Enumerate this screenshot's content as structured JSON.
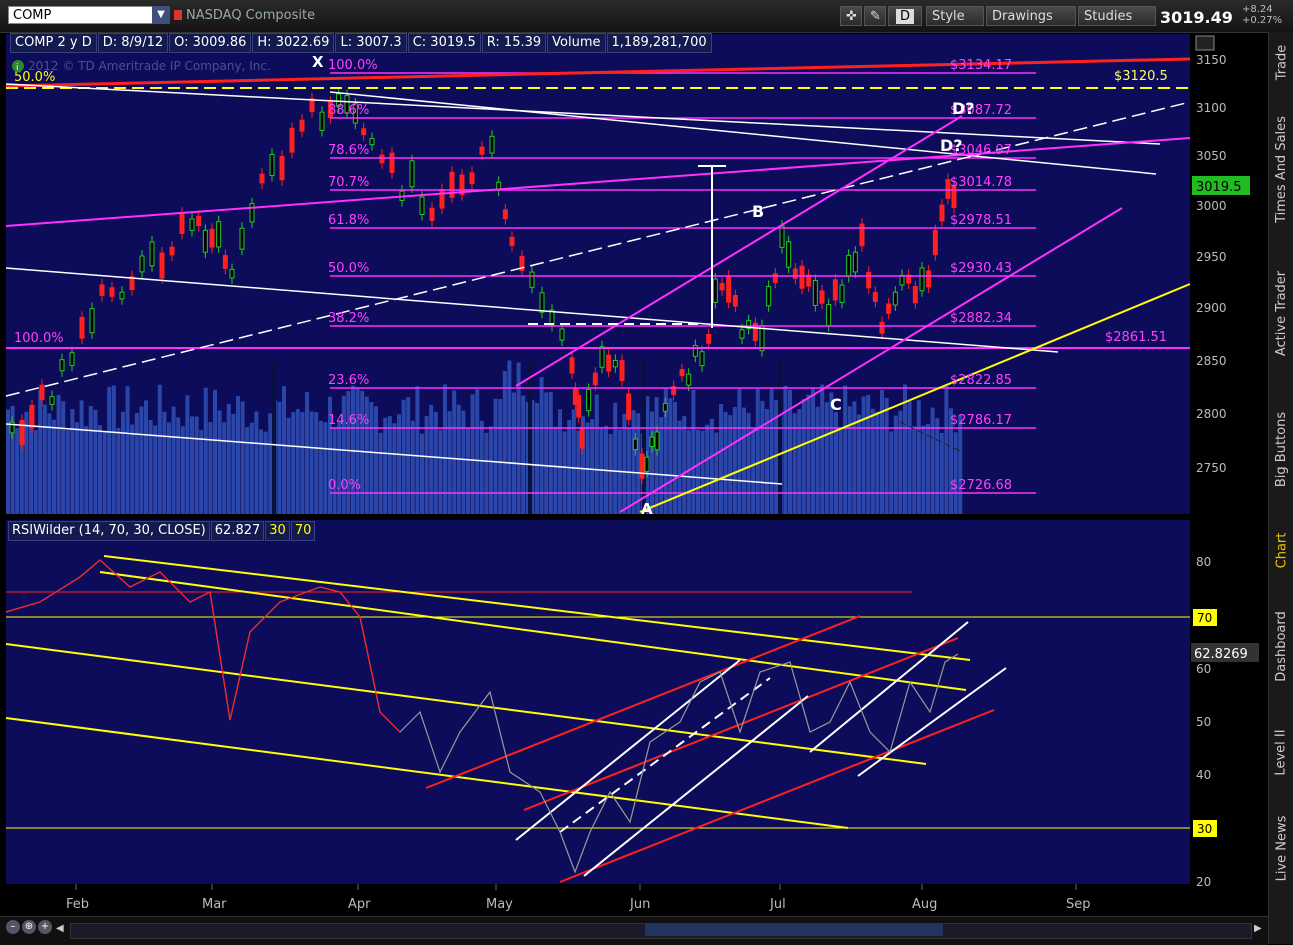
{
  "toolbar": {
    "symbol": "COMP",
    "symbol_name": "NASDAQ Composite",
    "style_label": "Style",
    "drawings_label": "Drawings",
    "studies_label": "Studies",
    "d_label": "D",
    "last_price": "3019.49",
    "change_abs": "+8.24",
    "change_pct": "+0.27%"
  },
  "info_bar": {
    "symbol_period": "COMP 2 y D",
    "date": "D: 8/9/12",
    "open": "O: 3009.86",
    "high": "H: 3022.69",
    "low": "L: 3007.3",
    "close": "C: 3019.5",
    "range": "R: 15.39",
    "volume_label": "Volume",
    "volume": "1,189,281,700"
  },
  "copyright": "2012 © TD Ameritrade IP Company, Inc.",
  "price_axis": {
    "ticks": [
      "3150",
      "3100",
      "3050",
      "3000",
      "2950",
      "2900",
      "2850",
      "2800",
      "2750"
    ],
    "current": "3019.5"
  },
  "fib_labels": [
    {
      "pct": "100.0%",
      "price": "$3134.17"
    },
    {
      "pct": "88.6%",
      "price": "$3087.72"
    },
    {
      "pct": "78.6%",
      "price": "$3046.97"
    },
    {
      "pct": "70.7%",
      "price": "$3014.78"
    },
    {
      "pct": "61.8%",
      "price": "$2978.51"
    },
    {
      "pct": "50.0%",
      "price": "$2930.43"
    },
    {
      "pct": "38.2%",
      "price": "$2882.34"
    },
    {
      "pct": "23.6%",
      "price": "$2822.85"
    },
    {
      "pct": "14.6%",
      "price": "$2786.17"
    },
    {
      "pct": "0.0%",
      "price": "$2726.68"
    }
  ],
  "annotations": {
    "left_100": "100.0%",
    "left_50": "50.0%",
    "x": "X",
    "a": "A",
    "b": "B",
    "c": "C",
    "d1": "D?",
    "d2": "D?",
    "level_3120": "$3120.5",
    "level_2861": "$2861.51"
  },
  "rsi": {
    "title": "RSIWilder (14, 70, 30, CLOSE)",
    "value": "62.827",
    "ob": "30",
    "os": "70",
    "axis": [
      "80",
      "60",
      "50",
      "40",
      "20"
    ],
    "marker70": "70",
    "marker30": "30",
    "current": "62.8269"
  },
  "time_axis": [
    "Feb",
    "Mar",
    "Apr",
    "May",
    "Jun",
    "Jul",
    "Aug",
    "Sep"
  ],
  "right_tabs": [
    "Trade",
    "Times And Sales",
    "Active Trader",
    "Big Buttons",
    "Chart",
    "Dashboard",
    "Level II",
    "Live News"
  ],
  "colors": {
    "chart_bg": "#0c0c5a",
    "magenta": "#ff30ff",
    "yellow": "#ffff00",
    "red": "#ff2020",
    "green": "#22cc22"
  }
}
